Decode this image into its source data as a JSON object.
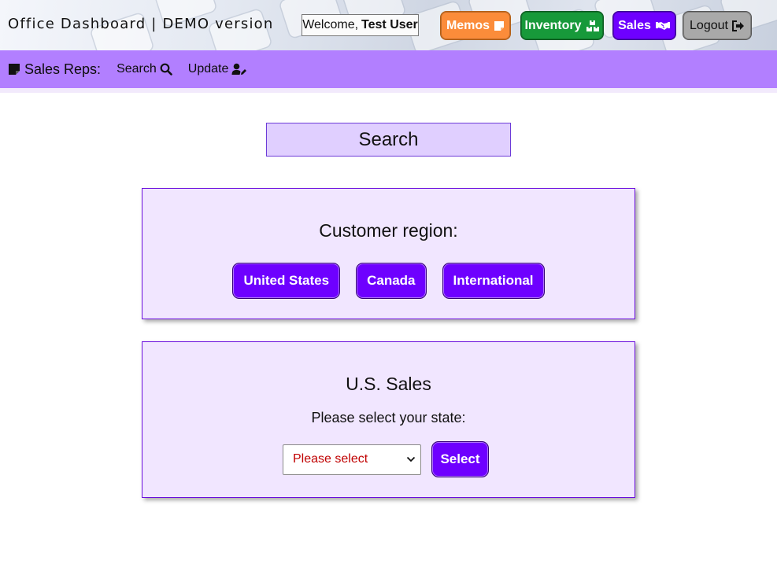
{
  "header": {
    "app_title": "Office Dashboard | DEMO version",
    "welcome_prefix": "Welcome,",
    "welcome_user": "Test User",
    "buttons": {
      "memos": "Memos",
      "inventory": "Inventory",
      "sales": "Sales",
      "logout": "Logout"
    },
    "colors": {
      "memos": "#fb8c3a",
      "inventory": "#17993a",
      "sales": "#6e00ff",
      "logout": "#a9a9a9"
    }
  },
  "subnav": {
    "section_title": "Sales Reps:",
    "links": {
      "search": "Search",
      "update": "Update"
    },
    "color": "#b27fff"
  },
  "main": {
    "heading": "Search",
    "region_panel": {
      "title": "Customer region:",
      "buttons": [
        "United States",
        "Canada",
        "International"
      ]
    },
    "sales_panel": {
      "title": "U.S. Sales",
      "state_label": "Please select your state:",
      "select_value": "Please select",
      "select_button": "Select"
    },
    "accent": "#6e00ff"
  },
  "icons": {
    "memos": "sticky-note-icon",
    "inventory": "boxes-icon",
    "sales": "handshake-icon",
    "logout": "sign-out-icon",
    "section": "note-icon",
    "search": "magnifier-icon",
    "update": "user-edit-icon",
    "select": "chevron-down-icon"
  }
}
